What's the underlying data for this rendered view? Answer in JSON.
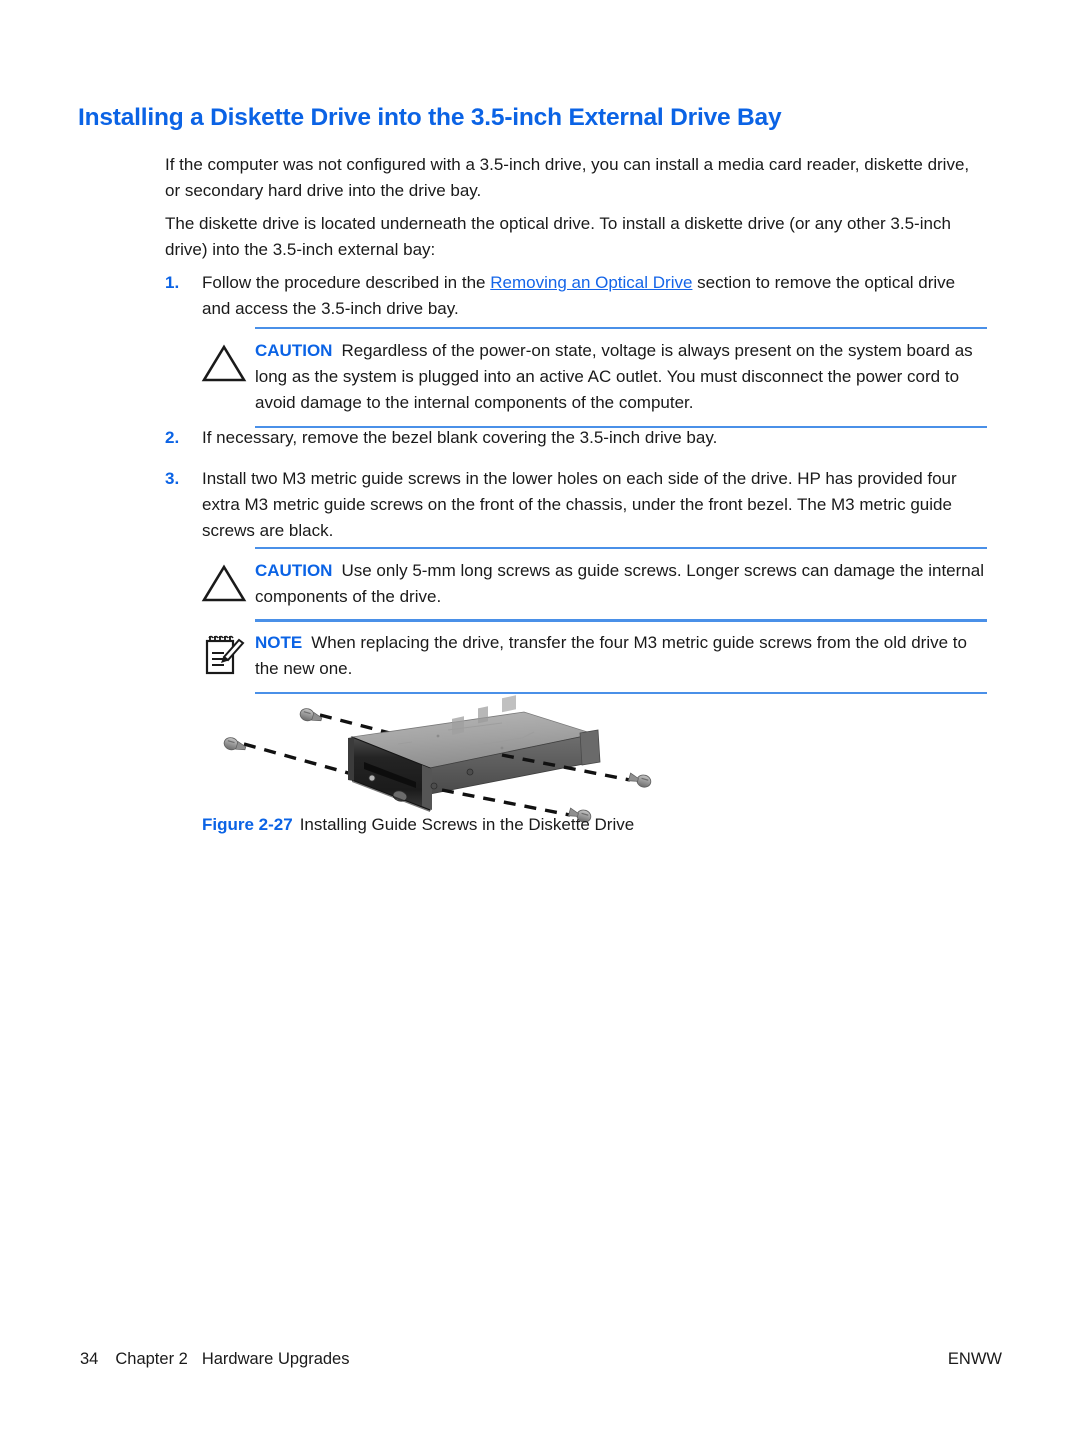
{
  "heading": "Installing a Diskette Drive into the 3.5-inch External Drive Bay",
  "colors": {
    "heading_blue": "#0b63e5",
    "label_blue": "#0b63e5",
    "link_blue": "#1565e8",
    "rule_blue": "#4a90e8",
    "body_black": "#1a1a1a"
  },
  "paragraphs": {
    "p1": "If the computer was not configured with a 3.5-inch drive, you can install a media card reader, diskette drive, or secondary hard drive into the drive bay.",
    "p2": "The diskette drive is located underneath the optical drive. To install a diskette drive (or any other 3.5-inch drive) into the 3.5-inch external bay:"
  },
  "steps": [
    {
      "number": "1.",
      "text_before_link": "Follow the procedure described in the ",
      "link_text": "Removing an Optical Drive",
      "text_after_link": " section to remove the optical drive and access the 3.5-inch drive bay."
    },
    {
      "number": "2.",
      "text": "If necessary, remove the bezel blank covering the 3.5-inch drive bay."
    },
    {
      "number": "3.",
      "text": "Install two M3 metric guide screws in the lower holes on each side of the drive. HP has provided four extra M3 metric guide screws on the front of the chassis, under the front bezel. The M3 metric guide screws are black."
    }
  ],
  "admonitions": [
    {
      "id": "caution-1",
      "icon": "caution-triangle-icon",
      "label": "CAUTION",
      "text": "Regardless of the power-on state, voltage is always present on the system board as long as the system is plugged into an active AC outlet. You must disconnect the power cord to avoid damage to the internal components of the computer."
    },
    {
      "id": "caution-2",
      "icon": "caution-triangle-icon",
      "label": "CAUTION",
      "text": "Use only 5-mm long screws as guide screws. Longer screws can damage the internal components of the drive."
    },
    {
      "id": "note-1",
      "icon": "note-pad-pencil-icon",
      "label": "NOTE",
      "text": "When replacing the drive, transfer the four M3 metric guide screws from the old drive to the new one."
    }
  ],
  "figure": {
    "number": "Figure 2-27",
    "caption": "Installing Guide Screws in the Diskette Drive",
    "illustration_name": "diskette-drive-guide-screws-illustration",
    "screw_count": 4
  },
  "footer": {
    "page_number": "34",
    "chapter": "Chapter 2",
    "chapter_title": "Hardware Upgrades",
    "language_code": "ENWW"
  }
}
